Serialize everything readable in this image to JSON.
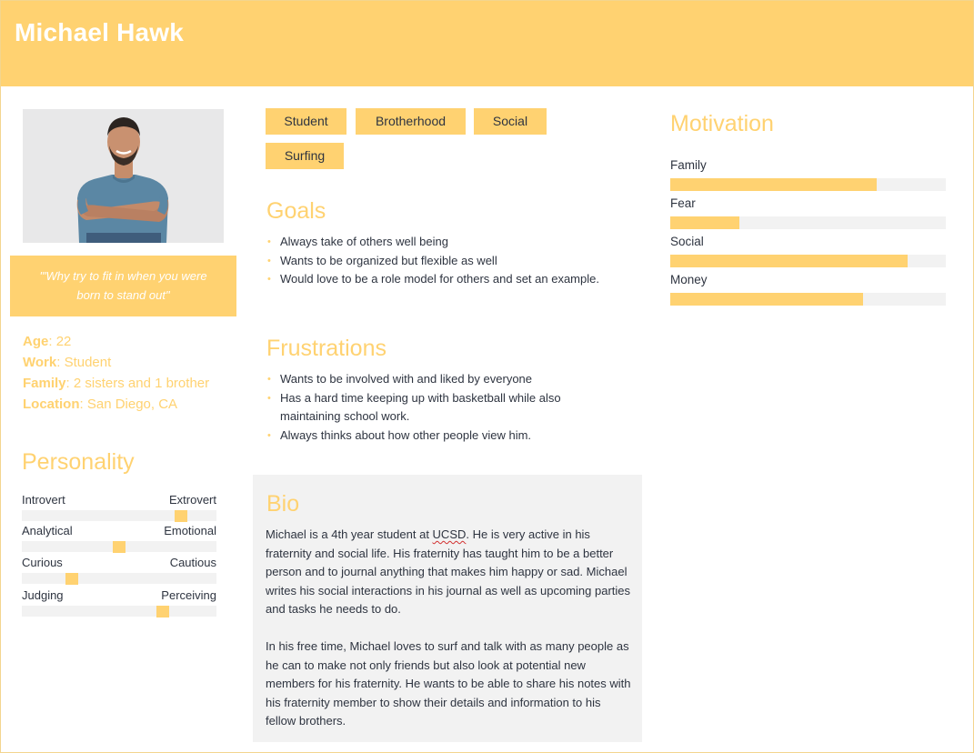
{
  "persona": {
    "name": "Michael Hawk",
    "quote": "\"'Why try to fit in when you were born to stand out\"",
    "facts": [
      {
        "label": "Age",
        "value": "22"
      },
      {
        "label": "Work",
        "value": "Student"
      },
      {
        "label": "Family",
        "value": "2 sisters and 1 brother"
      },
      {
        "label": "Location",
        "value": "San Diego, CA"
      }
    ]
  },
  "tags": [
    "Student",
    "Brotherhood",
    "Social",
    "Surfing"
  ],
  "goals": {
    "title": "Goals",
    "items": [
      "Always take of others well being",
      "Wants to be organized but flexible as well",
      "Would love to be a role model for others and set an example."
    ]
  },
  "frustrations": {
    "title": "Frustrations",
    "items": [
      "Wants to be involved with and liked by everyone",
      "Has a hard time keeping up with basketball while also maintaining school work.",
      "Always thinks about how other people view him."
    ]
  },
  "personality": {
    "title": "Personality",
    "traits": [
      {
        "left": "Introvert",
        "right": "Extrovert",
        "position": 0.84
      },
      {
        "left": "Analytical",
        "right": "Emotional",
        "position": 0.5
      },
      {
        "left": "Curious",
        "right": "Cautious",
        "position": 0.24
      },
      {
        "left": "Judging",
        "right": "Perceiving",
        "position": 0.74
      }
    ]
  },
  "bio": {
    "title": "Bio",
    "p1_before": "Michael is a 4th year student at ",
    "p1_flag": "UCSD",
    "p1_after": ". He is very active in his fraternity and social life. His fraternity has taught him to be a better person and to journal anything that makes him happy or sad. Michael writes his social interactions in his journal as well as upcoming parties and tasks he needs to do.",
    "p2": "In his free time, Michael loves to surf and talk with as many people as he can to make not only friends but also look at potential new members for his fraternity. He wants to be able to share his notes with his fraternity member to show their details and information to his fellow brothers."
  },
  "motivation": {
    "title": "Motivation",
    "items": [
      {
        "label": "Family",
        "level": 0.75
      },
      {
        "label": "Fear",
        "level": 0.25
      },
      {
        "label": "Social",
        "level": 0.86
      },
      {
        "label": "Money",
        "level": 0.7
      }
    ]
  },
  "colors": {
    "accent": "#ffd271",
    "panel": "#f2f2f2",
    "text": "#2e3440"
  },
  "icons": {
    "photo": "person-photo"
  }
}
